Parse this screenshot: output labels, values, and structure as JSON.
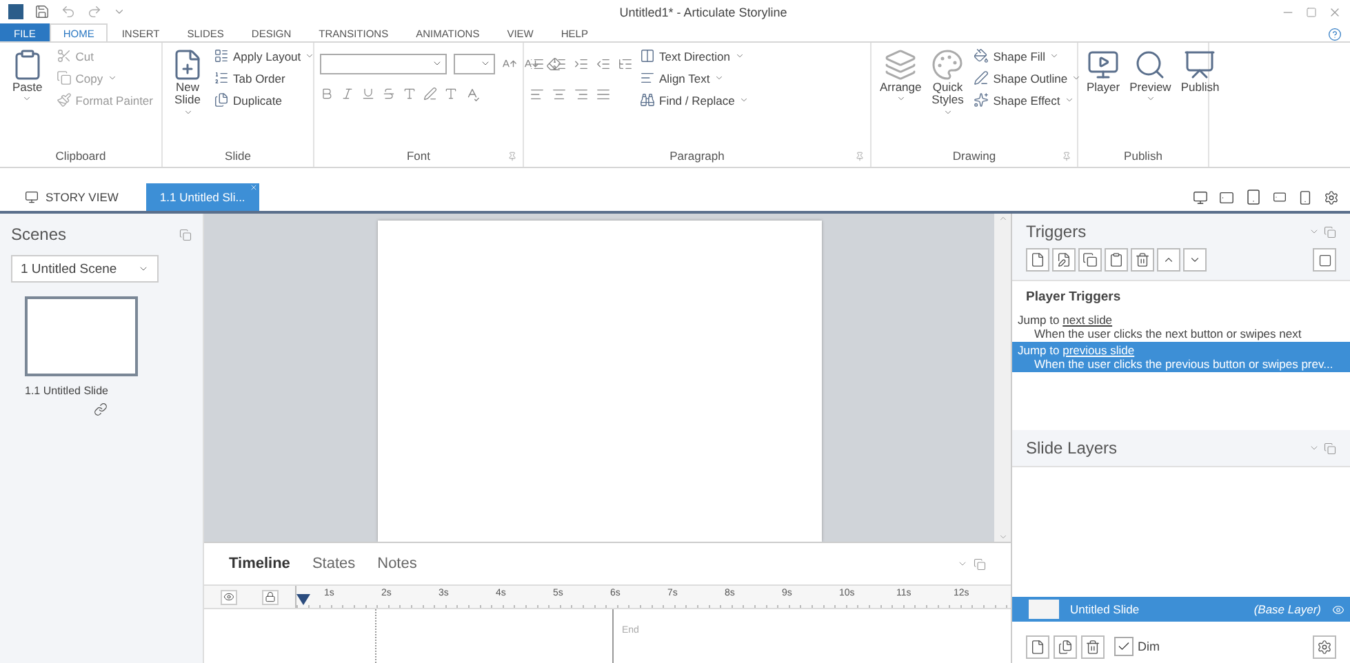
{
  "window": {
    "title": "Untitled1* - Articulate Storyline"
  },
  "ribbon_tabs": [
    {
      "label": "FILE",
      "kind": "file",
      "selected": false
    },
    {
      "label": "HOME",
      "kind": "tab",
      "selected": true
    },
    {
      "label": "INSERT",
      "kind": "tab",
      "selected": false
    },
    {
      "label": "SLIDES",
      "kind": "tab",
      "selected": false
    },
    {
      "label": "DESIGN",
      "kind": "tab",
      "selected": false
    },
    {
      "label": "TRANSITIONS",
      "kind": "tab",
      "selected": false
    },
    {
      "label": "ANIMATIONS",
      "kind": "tab",
      "selected": false
    },
    {
      "label": "VIEW",
      "kind": "tab",
      "selected": false
    },
    {
      "label": "HELP",
      "kind": "tab",
      "selected": false
    }
  ],
  "ribbon_groups": [
    {
      "label": "Clipboard",
      "kind": "clipboard",
      "launcher": false,
      "large": [
        {
          "label": "Paste",
          "dropdown": true
        }
      ],
      "small": [
        {
          "label": "Cut",
          "dropdown": false,
          "disabled": true
        },
        {
          "label": "Copy",
          "dropdown": true,
          "disabled": true
        },
        {
          "label": "Format Painter",
          "dropdown": false,
          "disabled": true
        }
      ]
    },
    {
      "label": "Slide",
      "kind": "slide",
      "launcher": false,
      "large": [
        {
          "label": "New Slide",
          "dropdown": true
        }
      ],
      "small": [
        {
          "label": "Apply Layout",
          "dropdown": true,
          "disabled": false
        },
        {
          "label": "Tab Order",
          "dropdown": false,
          "disabled": false
        },
        {
          "label": "Duplicate",
          "dropdown": false,
          "disabled": false
        }
      ]
    },
    {
      "label": "Font",
      "kind": "font",
      "launcher": true
    },
    {
      "label": "Paragraph",
      "kind": "paragraph",
      "launcher": true,
      "small": [
        {
          "label": "Text Direction",
          "dropdown": true,
          "disabled": false
        },
        {
          "label": "Align Text",
          "dropdown": true,
          "disabled": false
        },
        {
          "label": "Find / Replace",
          "dropdown": true,
          "disabled": false
        }
      ]
    },
    {
      "label": "Drawing",
      "kind": "drawing",
      "launcher": true,
      "large": [
        {
          "label": "Arrange",
          "dropdown": true
        },
        {
          "label": "Quick Styles",
          "dropdown": true
        }
      ],
      "small": [
        {
          "label": "Shape Fill",
          "dropdown": true,
          "disabled": false
        },
        {
          "label": "Shape Outline",
          "dropdown": true,
          "disabled": false
        },
        {
          "label": "Shape Effect",
          "dropdown": true,
          "disabled": false
        }
      ]
    },
    {
      "label": "Publish",
      "kind": "publish",
      "launcher": false,
      "large": [
        {
          "label": "Player",
          "dropdown": false
        },
        {
          "label": "Preview",
          "dropdown": true
        },
        {
          "label": "Publish",
          "dropdown": false
        }
      ]
    }
  ],
  "doc_tabs": [
    {
      "label": "STORY VIEW",
      "kind": "story",
      "selected": false
    },
    {
      "label": "1.1 Untitled Sli...",
      "kind": "slide",
      "selected": true
    }
  ],
  "scenes": {
    "title": "Scenes",
    "dropdown": "1 Untitled Scene",
    "slides": [
      {
        "label": "1.1 Untitled Slide"
      }
    ]
  },
  "timeline": {
    "tabs": [
      {
        "label": "Timeline",
        "selected": true
      },
      {
        "label": "States",
        "selected": false
      },
      {
        "label": "Notes",
        "selected": false
      }
    ],
    "ticks": [
      "1s",
      "2s",
      "3s",
      "4s",
      "5s",
      "6s",
      "7s",
      "8s",
      "9s",
      "10s",
      "11s",
      "12s"
    ],
    "end_label": "End"
  },
  "triggers": {
    "title": "Triggers",
    "section": "Player Triggers",
    "items": [
      {
        "action": "Jump to",
        "target": "next slide",
        "condition": "When the user clicks the next button or swipes next",
        "selected": false
      },
      {
        "action": "Jump to",
        "target": "previous slide",
        "condition": "When the user clicks the previous button or swipes prev...",
        "selected": true
      }
    ]
  },
  "slide_layers": {
    "title": "Slide Layers",
    "layers": [
      {
        "name": "Untitled Slide",
        "tag": "(Base Layer)",
        "selected": true
      }
    ],
    "dim": {
      "label": "Dim",
      "checked": true
    }
  }
}
